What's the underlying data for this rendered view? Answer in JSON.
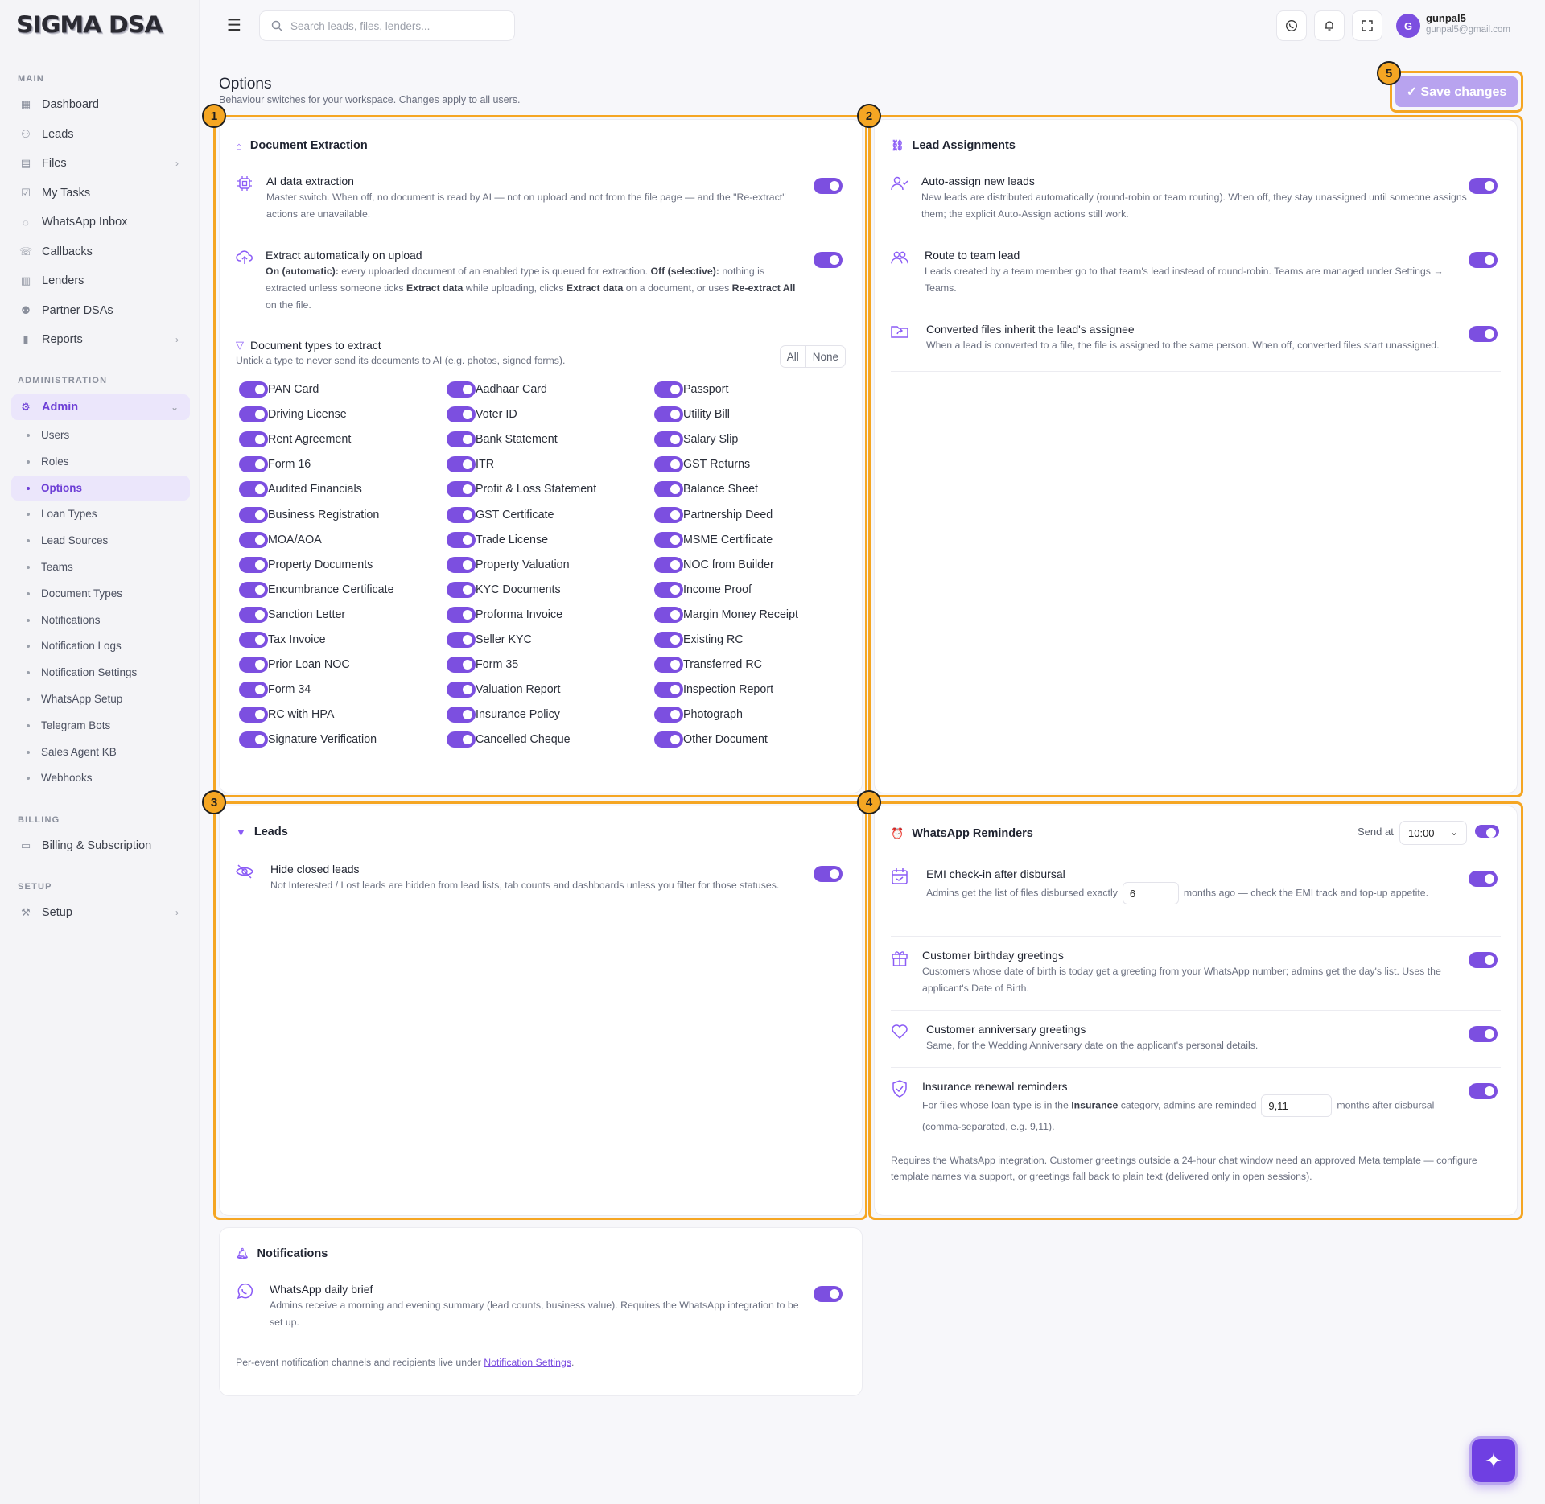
{
  "app": {
    "logo": "SIGMA DSA"
  },
  "search": {
    "placeholder": "Search leads, files, lenders..."
  },
  "user": {
    "initial": "G",
    "name": "gunpal5",
    "email": "gunpal5@gmail.com"
  },
  "sidebar": {
    "main_label": "MAIN",
    "main": [
      {
        "label": "Dashboard",
        "icon": "grid-icon"
      },
      {
        "label": "Leads",
        "icon": "user-plus-icon"
      },
      {
        "label": "Files",
        "icon": "file-icon"
      },
      {
        "label": "My Tasks",
        "icon": "task-icon"
      },
      {
        "label": "WhatsApp Inbox",
        "icon": "whatsapp-icon"
      },
      {
        "label": "Callbacks",
        "icon": "phone-icon"
      },
      {
        "label": "Lenders",
        "icon": "building-icon"
      },
      {
        "label": "Partner DSAs",
        "icon": "partner-icon"
      },
      {
        "label": "Reports",
        "icon": "bar-chart-icon"
      }
    ],
    "admin_label": "ADMINISTRATION",
    "admin": {
      "label": "Admin"
    },
    "admin_sub": [
      "Users",
      "Roles",
      "Options",
      "Loan Types",
      "Lead Sources",
      "Teams",
      "Document Types",
      "Notifications",
      "Notification Logs",
      "Notification Settings",
      "WhatsApp Setup",
      "Telegram Bots",
      "Sales Agent KB",
      "Webhooks"
    ],
    "billing_label": "BILLING",
    "billing": {
      "label": "Billing & Subscription"
    },
    "setup_label": "SETUP",
    "setup": {
      "label": "Setup"
    }
  },
  "page": {
    "title": "Options",
    "subtitle": "Behaviour switches for your workspace. Changes apply to all users.",
    "save_label": "✓ Save changes"
  },
  "callouts": [
    "1",
    "2",
    "3",
    "4",
    "5"
  ],
  "doc_extraction": {
    "title": "Document Extraction",
    "ai": {
      "title": "AI data extraction",
      "desc": "Master switch. When off, no document is read by AI — not on upload and not from the file page — and the \"Re-extract\" actions are unavailable.",
      "enabled": true
    },
    "auto": {
      "title": "Extract automatically on upload",
      "d1b": "On (automatic):",
      "d1": " every uploaded document of an enabled type is queued for extraction. ",
      "d2b": "Off (selective):",
      "d2": " nothing is extracted unless someone ticks ",
      "d3b": "Extract data",
      "d3": " while uploading, clicks ",
      "d4b": "Extract data",
      "d4": " on a document, or uses ",
      "d5b": "Re-extract All",
      "d5": " on the file.",
      "enabled": true
    },
    "types": {
      "title": "Document types to extract",
      "desc": "Untick a type to never send its documents to AI (e.g. photos, signed forms).",
      "all_label": "All",
      "none_label": "None",
      "items": [
        "PAN Card",
        "Aadhaar Card",
        "Passport",
        "Driving License",
        "Voter ID",
        "Utility Bill",
        "Rent Agreement",
        "Bank Statement",
        "Salary Slip",
        "Form 16",
        "ITR",
        "GST Returns",
        "Audited Financials",
        "Profit & Loss Statement",
        "Balance Sheet",
        "Business Registration",
        "GST Certificate",
        "Partnership Deed",
        "MOA/AOA",
        "Trade License",
        "MSME Certificate",
        "Property Documents",
        "Property Valuation",
        "NOC from Builder",
        "Encumbrance Certificate",
        "KYC Documents",
        "Income Proof",
        "Sanction Letter",
        "Proforma Invoice",
        "Margin Money Receipt",
        "Tax Invoice",
        "Seller KYC",
        "Existing RC",
        "Prior Loan NOC",
        "Form 35",
        "Transferred RC",
        "Form 34",
        "Valuation Report",
        "Inspection Report",
        "RC with HPA",
        "Insurance Policy",
        "Photograph",
        "Signature Verification",
        "Cancelled Cheque",
        "Other Document"
      ]
    }
  },
  "lead_assign": {
    "title": "Lead Assignments",
    "items": [
      {
        "title": "Auto-assign new leads",
        "desc": "New leads are distributed automatically (round-robin or team routing). When off, they stay unassigned until someone assigns them; the explicit Auto-Assign actions still work.",
        "enabled": true
      },
      {
        "title": "Route to team lead",
        "desc": "Leads created by a team member go to that team's lead instead of round-robin. Teams are managed under Settings → Teams.",
        "enabled": true
      },
      {
        "title": "Converted files inherit the lead's assignee",
        "desc": "When a lead is converted to a file, the file is assigned to the same person. When off, converted files start unassigned.",
        "enabled": true
      }
    ]
  },
  "leads": {
    "title": "Leads",
    "hide": {
      "title": "Hide closed leads",
      "desc": "Not Interested / Lost leads are hidden from lead lists, tab counts and dashboards unless you filter for those statuses.",
      "enabled": true
    }
  },
  "wa_reminders": {
    "title": "WhatsApp Reminders",
    "send_at_label": "Send at",
    "send_at": "10:00",
    "enabled": true,
    "emi": {
      "title": "EMI check-in after disbursal",
      "d1": "Admins get the list of files disbursed exactly",
      "value": "6",
      "d2": "months ago — check the EMI track and top-up appetite.",
      "enabled": true
    },
    "birthday": {
      "title": "Customer birthday greetings",
      "desc": "Customers whose date of birth is today get a greeting from your WhatsApp number; admins get the day's list. Uses the applicant's Date of Birth.",
      "enabled": true
    },
    "anniv": {
      "title": "Customer anniversary greetings",
      "desc": "Same, for the Wedding Anniversary date on the applicant's personal details.",
      "enabled": true
    },
    "insurance": {
      "title": "Insurance renewal reminders",
      "d1": "For files whose loan type is in the ",
      "d1b": "Insurance",
      "d2": " category, admins are reminded",
      "value": "9,11",
      "d3": "months after disbursal (comma-separated, e.g. 9,11).",
      "enabled": true
    },
    "footer": "Requires the WhatsApp integration. Customer greetings outside a 24-hour chat window need an approved Meta template — configure template names via support, or greetings fall back to plain text (delivered only in open sessions)."
  },
  "notifications": {
    "title": "Notifications",
    "brief": {
      "title": "WhatsApp daily brief",
      "desc": "Admins receive a morning and evening summary (lead counts, business value). Requires the WhatsApp integration to be set up.",
      "enabled": true
    },
    "footer_pre": "Per-event notification channels and recipients live under ",
    "footer_link": "Notification Settings",
    "footer_post": "."
  },
  "colors": {
    "accent": "#7c4fe0",
    "highlight": "#f5a623"
  }
}
